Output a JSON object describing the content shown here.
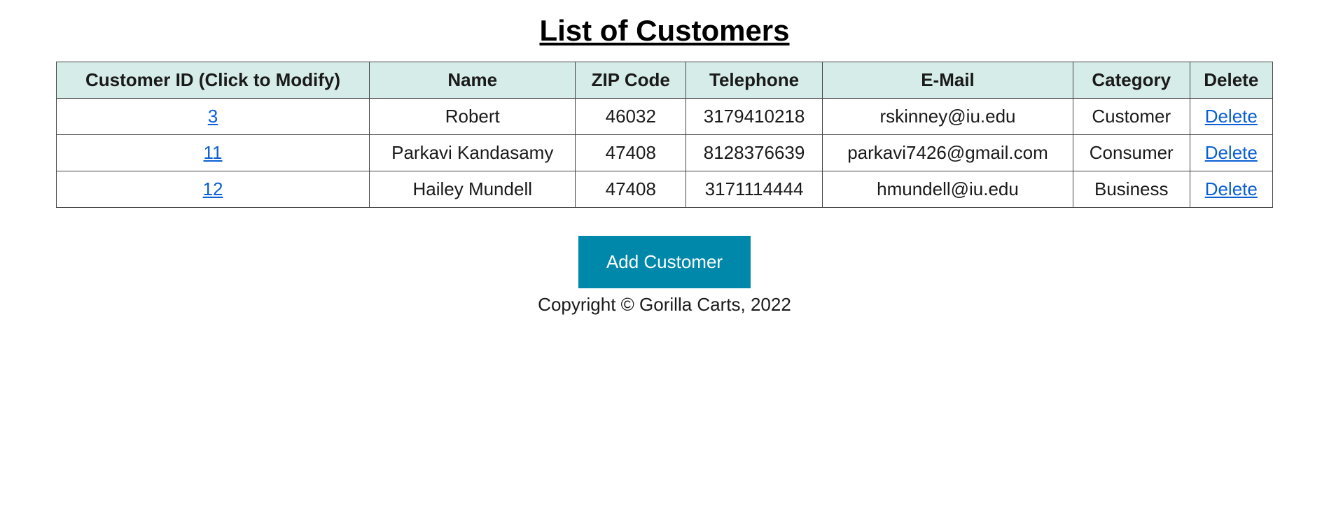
{
  "page_title": "List of Customers",
  "table": {
    "headers": {
      "customer_id": "Customer ID (Click to Modify)",
      "name": "Name",
      "zip": "ZIP Code",
      "telephone": "Telephone",
      "email": "E-Mail",
      "category": "Category",
      "delete": "Delete"
    },
    "rows": [
      {
        "id": "3",
        "name": "Robert",
        "zip": "46032",
        "telephone": "3179410218",
        "email": "rskinney@iu.edu",
        "category": "Customer",
        "delete_label": "Delete"
      },
      {
        "id": "11",
        "name": "Parkavi Kandasamy",
        "zip": "47408",
        "telephone": "8128376639",
        "email": "parkavi7426@gmail.com",
        "category": "Consumer",
        "delete_label": "Delete"
      },
      {
        "id": "12",
        "name": "Hailey Mundell",
        "zip": "47408",
        "telephone": "3171114444",
        "email": "hmundell@iu.edu",
        "category": "Business",
        "delete_label": "Delete"
      }
    ]
  },
  "add_button_label": "Add Customer",
  "footer": "Copyright © Gorilla Carts, 2022"
}
